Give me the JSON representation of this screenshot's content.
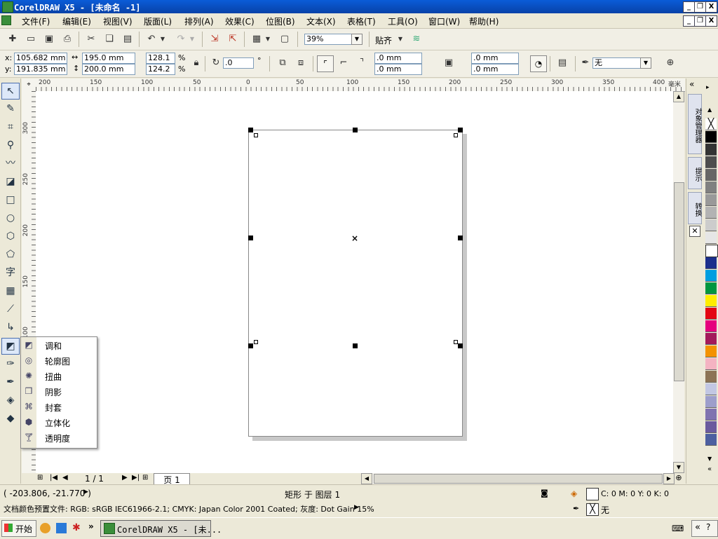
{
  "window": {
    "title": "CorelDRAW X5 - [未命名 -1]",
    "controls": {
      "minimize": "_",
      "restore": "❐",
      "close": "X"
    }
  },
  "menubar": {
    "items": [
      "文件(F)",
      "编辑(E)",
      "视图(V)",
      "版面(L)",
      "排列(A)",
      "效果(C)",
      "位图(B)",
      "文本(X)",
      "表格(T)",
      "工具(O)",
      "窗口(W)",
      "帮助(H)"
    ]
  },
  "standard_toolbar": {
    "zoom_value": "39%",
    "snap_label": "贴齐"
  },
  "property_bar": {
    "x_label": "x:",
    "x_value": "105.682 mm",
    "y_label": "y:",
    "y_value": "191.835 mm",
    "width_value": "195.0 mm",
    "height_value": "200.0 mm",
    "scale_x": "128.1",
    "scale_y": "124.2",
    "percent": "%",
    "rotation_value": ".0",
    "degree": "°",
    "corner1": ".0 mm",
    "corner2": ".0 mm",
    "corner3": ".0 mm",
    "corner4": ".0 mm",
    "outline_value": "无"
  },
  "ruler": {
    "unit": "毫米",
    "h_labels": [
      "200",
      "150",
      "100",
      "50",
      "0",
      "50",
      "100",
      "150",
      "200",
      "250",
      "300",
      "350",
      "400"
    ],
    "v_labels": [
      "300",
      "250",
      "200",
      "150",
      "100"
    ]
  },
  "page_nav": {
    "page_count": "1 / 1",
    "page_tab": "页 1"
  },
  "flyout": {
    "items": [
      {
        "icon": "blend-icon",
        "label": "调和"
      },
      {
        "icon": "contour-icon",
        "label": "轮廓图"
      },
      {
        "icon": "distort-icon",
        "label": "扭曲"
      },
      {
        "icon": "drop-shadow-icon",
        "label": "阴影"
      },
      {
        "icon": "envelope-icon",
        "label": "封套"
      },
      {
        "icon": "extrude-icon",
        "label": "立体化"
      },
      {
        "icon": "transparency-icon",
        "label": "透明度"
      }
    ]
  },
  "docker": {
    "tab1": "对象管理器",
    "tab2": "提示",
    "tab3": "转换"
  },
  "palette": {
    "colors": [
      "#000000",
      "#333333",
      "#4d4d4d",
      "#666666",
      "#808080",
      "#999999",
      "#b3b3b3",
      "#cccccc",
      "#e6e6e6",
      "#ffffff",
      "#1c2f8c",
      "#009ee0",
      "#009640",
      "#ffed00",
      "#e30613",
      "#e5007e",
      "#a3195b",
      "#f39200",
      "#f4b3c2",
      "#8c7355",
      "#c2c7e3",
      "#9d9ecb",
      "#8073b0",
      "#6a5a9e",
      "#4c5fa0"
    ]
  },
  "status": {
    "coords": "( -203.806, -21.770 )",
    "selection": "矩形 于 图层 1",
    "fill": "C: 0 M: 0 Y: 0 K: 0",
    "outline": "无",
    "profile": "文档颜色预置文件: RGB: sRGB IEC61966-2.1; CMYK: Japan Color 2001 Coated; 灰度: Dot Gain 15%"
  },
  "taskbar": {
    "start": "开始",
    "app": "CorelDRAW X5 - [未..."
  }
}
